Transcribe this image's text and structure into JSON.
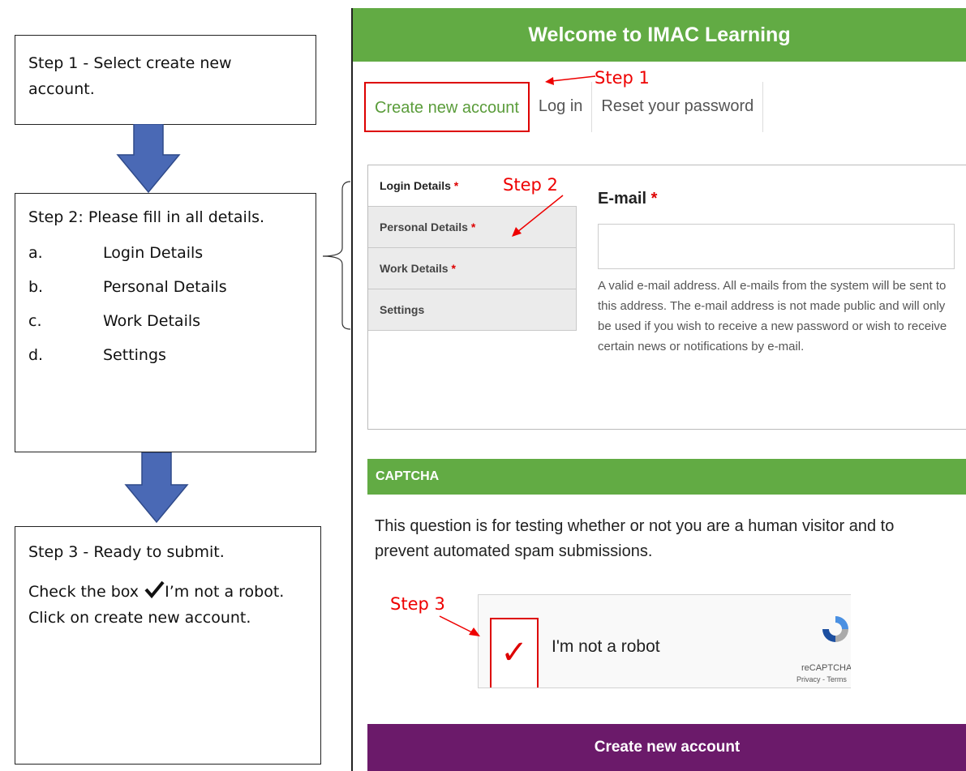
{
  "guide": {
    "step1": "Step 1 - Select create new account.",
    "step2_intro": "Step 2: Please fill in all details.",
    "step2_items": [
      {
        "letter": "a.",
        "label": "Login Details"
      },
      {
        "letter": "b.",
        "label": "Personal Details"
      },
      {
        "letter": "c.",
        "label": "Work Details"
      },
      {
        "letter": "d.",
        "label": "Settings"
      }
    ],
    "step3_line1": "Step 3 - Ready to submit.",
    "step3_pre": "Check the box",
    "step3_post": "I’m not a robot. Click on create new account."
  },
  "page": {
    "title": "Welcome to IMAC Learning",
    "tabs": [
      "Create new account",
      "Log in",
      "Reset your password"
    ],
    "vertical_tabs": [
      "Login Details",
      "Personal Details",
      "Work Details",
      "Settings"
    ],
    "required_marker": "*",
    "email_label": "E-mail",
    "email_value": "",
    "email_help": "A valid e-mail address. All e-mails from the system will be sent to this address. The e-mail address is not made public and will only be used if you wish to receive a new password or wish to receive certain news or notifications by e-mail.",
    "captcha_heading": "CAPTCHA",
    "captcha_description": "This question is for testing whether or not you are a human visitor and to prevent automated spam submissions.",
    "recaptcha": {
      "checkbox_mark": "✓",
      "label": "I'm not a robot",
      "brand": "reCAPTCHA",
      "links": "Privacy - Terms"
    },
    "submit_label": "Create new account"
  },
  "annotations": {
    "step1": "Step 1",
    "step2": "Step 2",
    "step3": "Step 3"
  },
  "colors": {
    "green": "#62ab44",
    "purple": "#6b1a6a",
    "annotation_red": "#e00000",
    "arrow_blue": "#4a69b5"
  }
}
